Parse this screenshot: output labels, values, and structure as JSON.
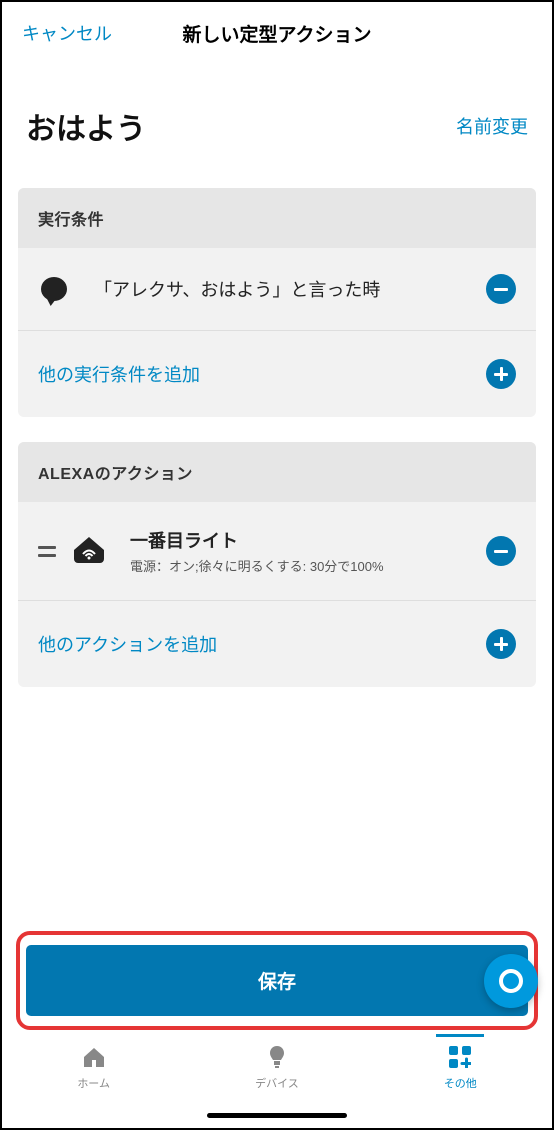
{
  "header": {
    "cancel": "キャンセル",
    "title": "新しい定型アクション"
  },
  "routine": {
    "name": "おはよう",
    "rename": "名前変更"
  },
  "conditions": {
    "header": "実行条件",
    "items": [
      {
        "text": "「アレクサ、おはよう」と言った時"
      }
    ],
    "add_label": "他の実行条件を追加"
  },
  "actions": {
    "header": "ALEXAのアクション",
    "items": [
      {
        "title": "一番目ライト",
        "subtitle": "電源：オン;徐々に明るくする: 30分で100%"
      }
    ],
    "add_label": "他のアクションを追加"
  },
  "save_button": "保存",
  "tabs": {
    "home": "ホーム",
    "devices": "デバイス",
    "other": "その他"
  }
}
